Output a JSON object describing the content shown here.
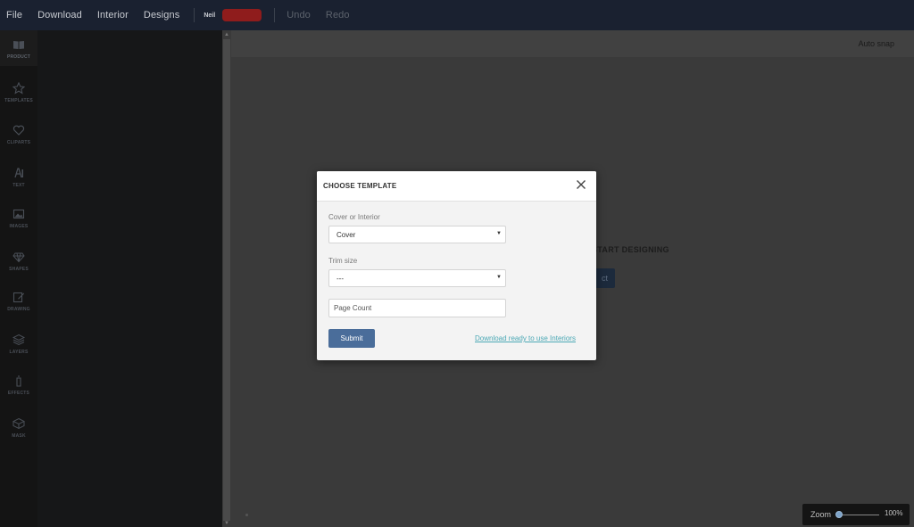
{
  "topbar": {
    "menu": [
      "File",
      "Download",
      "Interior",
      "Designs"
    ],
    "user_name": "Neil",
    "undo": "Undo",
    "redo": "Redo"
  },
  "rail": {
    "items": [
      {
        "label": "PRODUCT",
        "icon": "book-icon"
      },
      {
        "label": "TEMPLATES",
        "icon": "star-icon"
      },
      {
        "label": "CLIPARTS",
        "icon": "heart-icon"
      },
      {
        "label": "TEXT",
        "icon": "text-icon"
      },
      {
        "label": "IMAGES",
        "icon": "image-icon"
      },
      {
        "label": "SHAPES",
        "icon": "diamond-icon"
      },
      {
        "label": "DRAWING",
        "icon": "pencil-icon"
      },
      {
        "label": "LAYERS",
        "icon": "layers-icon"
      },
      {
        "label": "EFFECTS",
        "icon": "wand-icon"
      },
      {
        "label": "MASK",
        "icon": "mask-icon"
      }
    ]
  },
  "workspace": {
    "auto_snap": "Auto snap",
    "start_text": "START DESIGNING",
    "start_button_fragment": "ct"
  },
  "zoom": {
    "label": "Zoom",
    "value": "100%"
  },
  "modal": {
    "title": "CHOOSE TEMPLATE",
    "cover_label": "Cover or Interior",
    "cover_value": "Cover",
    "trim_label": "Trim size",
    "trim_value": "---",
    "page_count_placeholder": "Page Count",
    "submit_label": "Submit",
    "link_text": "Download ready to use Interiors"
  },
  "colors": {
    "topbar": "#1a2130",
    "accent": "#4a6d9a",
    "link": "#4ba8b5",
    "user_pill": "#8f1c1c"
  }
}
